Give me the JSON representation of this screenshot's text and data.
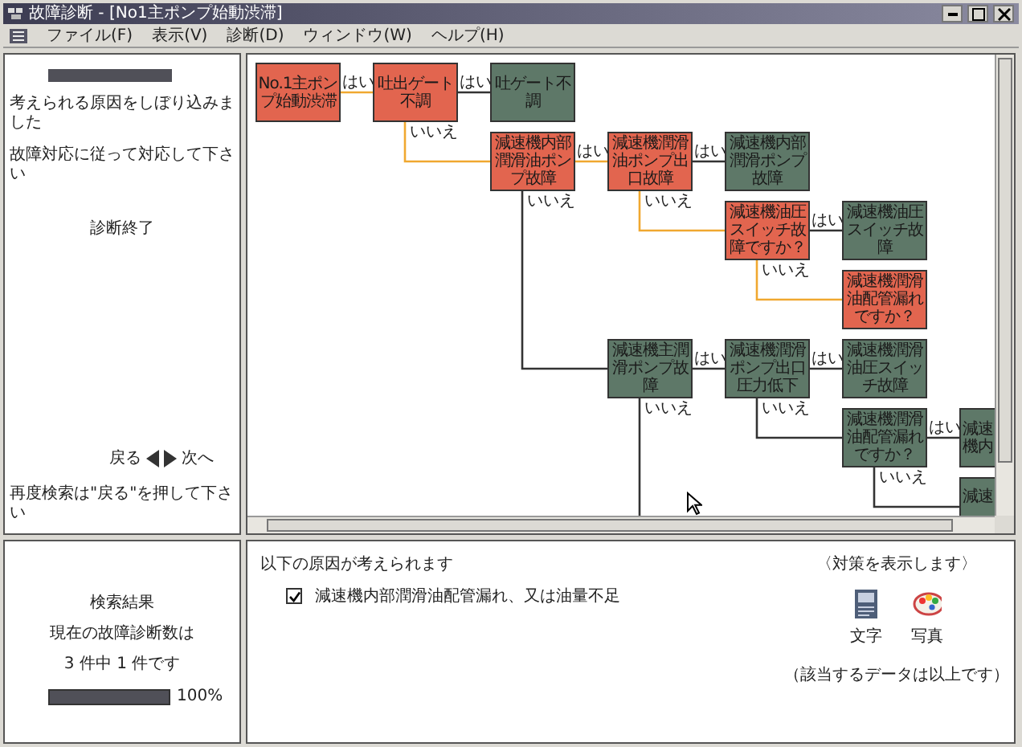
{
  "window": {
    "title": "故障診断 - [No1主ポンプ始動渋滞]"
  },
  "menu": [
    "ファイル(F)",
    "表示(V)",
    "診断(D)",
    "ウィンドウ(W)",
    "ヘルプ(H)"
  ],
  "guide": {
    "messages": [
      "考えられる原因をしぼり込みました",
      "故障対応に従って対応して下さい"
    ],
    "status": "診断終了",
    "back": "戻る",
    "next": "次へ",
    "hint": "再度検索は\"戻る\"を押して下さい"
  },
  "tree": {
    "text": "No.1主ポンプ始動渋滞",
    "suspected": true,
    "yes": {
      "label": "はい",
      "node": {
        "text": "吐出ゲート不調",
        "suspected": true,
        "yes": {
          "label": "はい",
          "node": {
            "text": "吐ゲート不調",
            "suspected": false
          }
        },
        "no": {
          "label": "いいえ",
          "node": {
            "text": "減速機内部潤滑油ポンプ故障",
            "suspected": true,
            "yes": {
              "label": "はい",
              "node": {
                "text": "減速機潤滑油ポンプ出口故障",
                "suspected": true,
                "yes": {
                  "label": "はい",
                  "node": {
                    "text": "減速機内部潤滑ポンプ故障",
                    "suspected": false
                  }
                },
                "no": {
                  "label": "いいえ",
                  "node": {
                    "text": "減速機油圧スイッチ故障ですか？",
                    "suspected": true,
                    "yes": {
                      "label": "はい",
                      "node": {
                        "text": "減速機油圧スイッチ故障",
                        "suspected": false
                      }
                    },
                    "no": {
                      "label": "いいえ",
                      "node": {
                        "text": "減速機潤滑油配管漏れですか？",
                        "suspected": true
                      }
                    }
                  }
                }
              }
            },
            "no": {
              "label": "いいえ",
              "node": {
                "text": "減速機主潤滑ポンプ故障",
                "suspected": false,
                "yes": {
                  "label": "はい",
                  "node": {
                    "text": "減速機潤滑ポンプ出口圧力低下",
                    "suspected": false,
                    "yes": {
                      "label": "はい",
                      "node": {
                        "text": "減速機潤滑油圧スイッチ故障",
                        "suspected": false
                      }
                    },
                    "no": {
                      "label": "いいえ",
                      "node": {
                        "text": "減速機潤滑油配管漏れですか？",
                        "suspected": false,
                        "yes": {
                          "label": "はい",
                          "node": {
                            "text": "減速機内",
                            "suspected": false
                          }
                        },
                        "no": {
                          "label": "いいえ",
                          "node": {
                            "text": "減速",
                            "suspected": false
                          }
                        }
                      }
                    }
                  }
                },
                "no": {
                  "label": "いいえ"
                }
              }
            }
          }
        }
      }
    }
  },
  "summary": {
    "title": "検索結果",
    "line1": "現在の故障診断数は",
    "line2": "3 件中 1 件です",
    "level": 1,
    "reading": "100%"
  },
  "causes": {
    "heading": "以下の原因が考えられます",
    "items": [
      {
        "text": "減速機内部潤滑油配管漏れ、又は油量不足",
        "checked": true
      }
    ]
  },
  "actions": {
    "heading": "〈対策を表示します〉",
    "buttons": [
      {
        "kind": "text",
        "label": "文字"
      },
      {
        "kind": "photo",
        "label": "写真"
      }
    ],
    "note": "（該当するデータは以上です）"
  }
}
